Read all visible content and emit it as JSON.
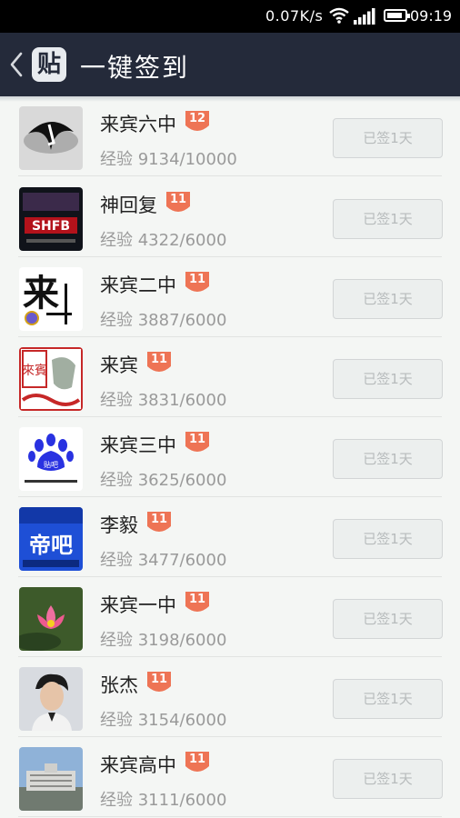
{
  "statusbar": {
    "net_speed": "0.07K/s",
    "time": "09:19",
    "battery_level": 0.9
  },
  "header": {
    "logo_text": "贴",
    "title": "一键签到"
  },
  "colors": {
    "header_bg": "#242a3a",
    "badge": "#ee7455",
    "button_text": "#b7bbbc"
  },
  "list": [
    {
      "name": "来宾六中",
      "level": "12",
      "exp": "经验 9134/10000",
      "button": "已签1天",
      "avatar": "ink-bird-logo"
    },
    {
      "name": "神回复",
      "level": "11",
      "exp": "经验 4322/6000",
      "button": "已签1天",
      "avatar": "shfb-logo",
      "avatar_text": "SHFB"
    },
    {
      "name": "来宾二中",
      "level": "11",
      "exp": "经验 3887/6000",
      "button": "已签1天",
      "avatar": "calligraphy-logo",
      "avatar_text": "来"
    },
    {
      "name": "来宾",
      "level": "11",
      "exp": "经验 3831/6000",
      "button": "已签1天",
      "avatar": "red-seal-logo",
      "avatar_text": "來賓"
    },
    {
      "name": "来宾三中",
      "level": "11",
      "exp": "经验 3625/6000",
      "button": "已签1天",
      "avatar": "paw-logo",
      "avatar_text": "贴吧"
    },
    {
      "name": "李毅",
      "level": "11",
      "exp": "经验 3477/6000",
      "button": "已签1天",
      "avatar": "blue-poster-logo",
      "avatar_text": "帝吧"
    },
    {
      "name": "来宾一中",
      "level": "11",
      "exp": "经验 3198/6000",
      "button": "已签1天",
      "avatar": "lotus-photo"
    },
    {
      "name": "张杰",
      "level": "11",
      "exp": "经验 3154/6000",
      "button": "已签1天",
      "avatar": "portrait-photo"
    },
    {
      "name": "来宾高中",
      "level": "11",
      "exp": "经验 3111/6000",
      "button": "已签1天",
      "avatar": "school-photo"
    }
  ]
}
